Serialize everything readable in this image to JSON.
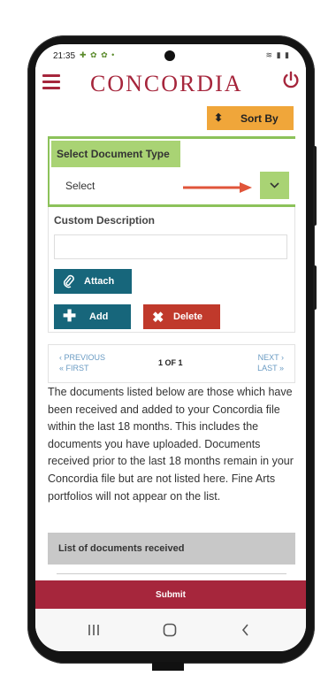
{
  "status_bar": {
    "time": "21:35",
    "notification_icons": "android-icon settings-icon settings-icon dot-icon",
    "right_icons": "wifi-icon signal-icon battery-icon"
  },
  "header": {
    "brand": "CONCORDIA",
    "brand_color": "#a6263c",
    "menu_icon": "hamburger-icon",
    "power_icon": "power-icon"
  },
  "toolbar": {
    "sort_label": "Sort By",
    "sort_icon": "sort-updown-icon",
    "sort_color": "#f0a63a"
  },
  "document_form": {
    "select_label": "Select Document Type",
    "select_value": "Select",
    "highlight_color": "#8cc25a",
    "custom_description_label": "Custom Description",
    "custom_description_value": "",
    "attach_label": "Attach",
    "add_label": "Add",
    "delete_label": "Delete",
    "button_color": "#17667b",
    "delete_color": "#c0392b"
  },
  "pagination": {
    "previous": "‹ PREVIOUS",
    "first": "« FIRST",
    "position": "1 OF 1",
    "next": "NEXT ›",
    "last": "LAST »"
  },
  "info_text": "The documents listed below are those which have been received and added to your Concordia file within the last 18 months. This includes the documents you have uploaded. Documents received prior to the last 18 months remain in your Concordia file but are not listed here. Fine Arts portfolios will not appear on the list.",
  "documents_section": {
    "title": "List of documents received"
  },
  "footer": {
    "submit_label": "Submit"
  },
  "android_nav": [
    "recents-icon",
    "home-icon",
    "back-icon"
  ]
}
